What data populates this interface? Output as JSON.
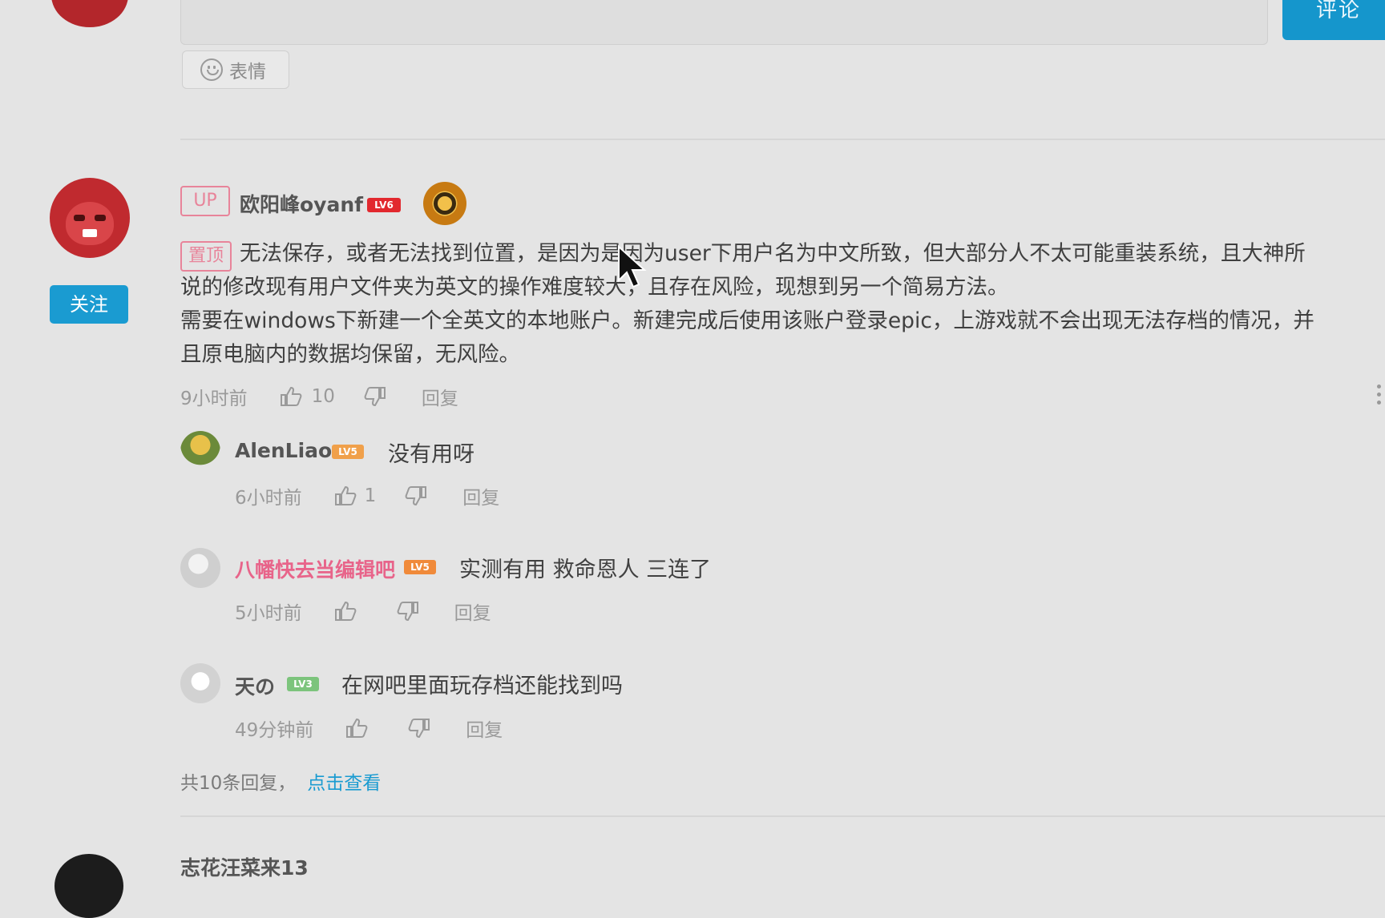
{
  "composer": {
    "submit_label": "评论",
    "emoji_label": "表情"
  },
  "main_comment": {
    "up_tag": "UP",
    "username": "欧阳峰oyanf",
    "level": "LV6",
    "pin_tag": "置顶",
    "lines": [
      "无法保存，或者无法找到位置，是因为是因为user下用户名为中文所致，但大部分人不太可能重装系统，且大神所",
      "说的修改现有用户文件夹为英文的操作难度较大，且存在风险，现想到另一个简易方法。",
      "需要在windows下新建一个全英文的本地账户。新建完成后使用该账户登录epic，上游戏就不会出现无法存档的情况，并",
      "且原电脑内的数据均保留，无风险。"
    ],
    "time": "9小时前",
    "like_count": "10",
    "reply_label": "回复",
    "follow_label": "关注"
  },
  "replies": [
    {
      "username": "AlenLiao",
      "level": "LV5",
      "level_color": "#f0a04a",
      "name_color": "#555555",
      "text": "没有用呀",
      "time": "6小时前",
      "like_count": "1",
      "reply_label": "回复"
    },
    {
      "username": "八幡快去当编辑吧",
      "level": "LV5",
      "level_color": "#f08a3a",
      "name_color": "#e8648a",
      "text": "实测有用 救命恩人 三连了",
      "time": "5小时前",
      "like_count": "",
      "reply_label": "回复"
    },
    {
      "username": "天の",
      "level": "LV3",
      "level_color": "#7cc47c",
      "name_color": "#555555",
      "text": "在网吧里面玩存档还能找到吗",
      "time": "49分钟前",
      "like_count": "",
      "reply_label": "回复"
    }
  ],
  "summary": {
    "text": "共10条回复，",
    "link": "点击查看"
  },
  "next_comment": {
    "username": "志花汪菜来13"
  }
}
